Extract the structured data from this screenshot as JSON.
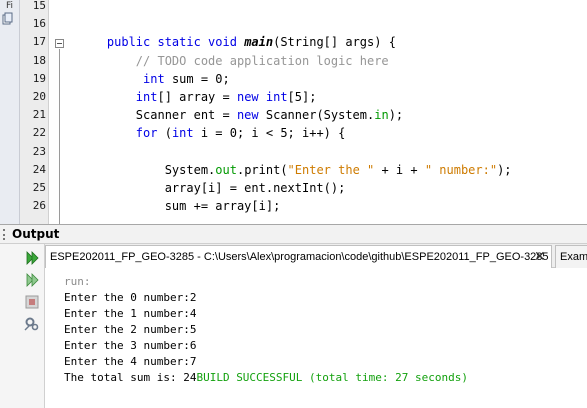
{
  "editor": {
    "side_label": "Fi",
    "lines": [
      {
        "n": "15",
        "segments": []
      },
      {
        "n": "16",
        "segments": []
      },
      {
        "n": "17",
        "indent": "    ",
        "segments": [
          {
            "t": "public static void ",
            "c": "kw"
          },
          {
            "t": "main",
            "c": "mth"
          },
          {
            "t": "(String[] args) {",
            "c": ""
          }
        ]
      },
      {
        "n": "18",
        "indent": "        ",
        "segments": [
          {
            "t": "// TODO code application logic here",
            "c": "cm"
          }
        ]
      },
      {
        "n": "19",
        "indent": "         ",
        "segments": [
          {
            "t": "int",
            "c": "kw"
          },
          {
            "t": " sum = 0;",
            "c": ""
          }
        ]
      },
      {
        "n": "20",
        "indent": "        ",
        "segments": [
          {
            "t": "int",
            "c": "kw"
          },
          {
            "t": "[] array = ",
            "c": ""
          },
          {
            "t": "new int",
            "c": "kw"
          },
          {
            "t": "[5];",
            "c": ""
          }
        ]
      },
      {
        "n": "21",
        "indent": "        ",
        "segments": [
          {
            "t": "Scanner ent = ",
            "c": ""
          },
          {
            "t": "new",
            "c": "kw"
          },
          {
            "t": " Scanner(System.",
            "c": ""
          },
          {
            "t": "in",
            "c": "fld"
          },
          {
            "t": ");",
            "c": ""
          }
        ]
      },
      {
        "n": "22",
        "indent": "        ",
        "segments": [
          {
            "t": "for",
            "c": "kw"
          },
          {
            "t": " (",
            "c": ""
          },
          {
            "t": "int",
            "c": "kw"
          },
          {
            "t": " i = 0; i < 5; i++) {",
            "c": ""
          }
        ]
      },
      {
        "n": "23",
        "segments": []
      },
      {
        "n": "24",
        "indent": "            ",
        "segments": [
          {
            "t": "System.",
            "c": ""
          },
          {
            "t": "out",
            "c": "fld"
          },
          {
            "t": ".print(",
            "c": ""
          },
          {
            "t": "\"Enter the \"",
            "c": "st"
          },
          {
            "t": " + i + ",
            "c": ""
          },
          {
            "t": "\" number:\"",
            "c": "st"
          },
          {
            "t": ");",
            "c": ""
          }
        ]
      },
      {
        "n": "25",
        "indent": "            ",
        "segments": [
          {
            "t": "array[i] = ent.nextInt();",
            "c": ""
          }
        ]
      },
      {
        "n": "26",
        "indent": "            ",
        "segments": [
          {
            "t": "sum += array[i];",
            "c": ""
          }
        ]
      }
    ]
  },
  "output": {
    "title": "Output",
    "tabs": [
      {
        "label": "ESPE202011_FP_GEO-3285 - C:\\Users\\Alex\\programacion\\code\\github\\ESPE202011_FP_GEO-3285",
        "close": "✕"
      },
      {
        "label": "Examl"
      }
    ],
    "toolbar": [
      "rerun",
      "rerun-with-options",
      "stop",
      "settings"
    ],
    "console": {
      "run_label": "run:",
      "lines": [
        "Enter the 0 number:2",
        "Enter the 1 number:4",
        "Enter the 2 number:5",
        "Enter the 3 number:6",
        "Enter the 4 number:7"
      ],
      "final_text": "The total sum is: 24",
      "build_status": "BUILD SUCCESSFUL (total time: 27 seconds)"
    }
  },
  "colors": {
    "keyword": "#0000e6",
    "comment": "#969696",
    "string": "#ce7b00",
    "field": "#009900",
    "success": "#13a10e"
  }
}
